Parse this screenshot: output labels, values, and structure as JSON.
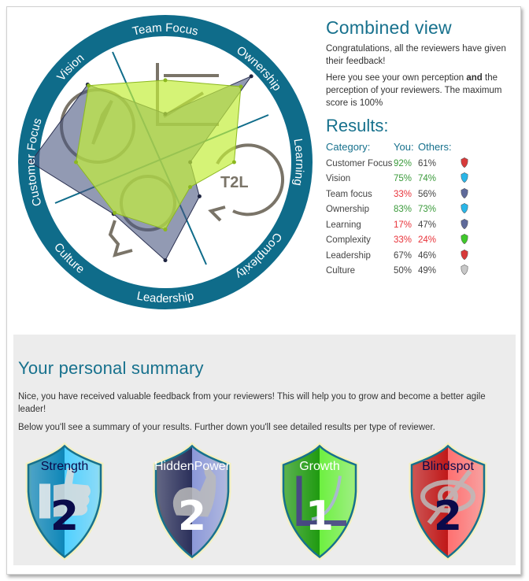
{
  "chart_data": {
    "type": "radar",
    "categories": [
      "Customer Focus",
      "Vision",
      "Team Focus",
      "Ownership",
      "Learning",
      "Complexity",
      "Leadership",
      "Culture"
    ],
    "series": [
      {
        "name": "You",
        "values": [
          92,
          75,
          33,
          83,
          17,
          33,
          67,
          50
        ],
        "color": "#4a5680"
      },
      {
        "name": "Others",
        "values": [
          61,
          74,
          56,
          73,
          47,
          24,
          46,
          49
        ],
        "color": "#c3ee3c"
      }
    ],
    "max": 100,
    "ring_color": "#0f6c8a",
    "icon_text": "T2L"
  },
  "header": {
    "title": "Combined view",
    "intro": "Congratulations, all the reviewers have given their feedback!",
    "desc_pre": "Here you see your own perception ",
    "desc_bold": "and",
    "desc_post": " the perception of your reviewers. The maximum score is 100%"
  },
  "results": {
    "title": "Results:",
    "col_category": "Category:",
    "col_you": "You:",
    "col_others": "Others:",
    "rows": [
      {
        "category": "Customer Focus",
        "you": "92%",
        "you_status": "good",
        "others": "61%",
        "others_status": "neutral",
        "shield": "#d83a3a"
      },
      {
        "category": "Vision",
        "you": "75%",
        "you_status": "good",
        "others": "74%",
        "others_status": "good",
        "shield": "#29b6e8"
      },
      {
        "category": "Team focus",
        "you": "33%",
        "you_status": "bad",
        "others": "56%",
        "others_status": "neutral",
        "shield": "#5f6a9a"
      },
      {
        "category": "Ownership",
        "you": "83%",
        "you_status": "good",
        "others": "73%",
        "others_status": "good",
        "shield": "#29b6e8"
      },
      {
        "category": "Learning",
        "you": "17%",
        "you_status": "bad",
        "others": "47%",
        "others_status": "neutral",
        "shield": "#5f6a9a"
      },
      {
        "category": "Complexity",
        "you": "33%",
        "you_status": "bad",
        "others": "24%",
        "others_status": "bad",
        "shield": "#3fc82a"
      },
      {
        "category": "Leadership",
        "you": "67%",
        "you_status": "neutral",
        "others": "46%",
        "others_status": "neutral",
        "shield": "#d83a3a"
      },
      {
        "category": "Culture",
        "you": "50%",
        "you_status": "neutral",
        "others": "49%",
        "others_status": "neutral",
        "shield": "#c8c8c8"
      }
    ]
  },
  "summary": {
    "title": "Your personal summary",
    "p1": "Nice, you have received valuable feedback from your reviewers! This will help you to grow and become a better agile leader!",
    "p2": "Below you'll see a summary of your results. Further down you'll see detailed results per type of reviewer.",
    "badges": [
      {
        "label": "Strength",
        "count": "2",
        "icon": "thumbs-up-icon",
        "dark": "#0d86b8",
        "light": "#4fd0ff",
        "text": "#0a0a4a",
        "num": "#0a0a4a"
      },
      {
        "label": "HiddenPower",
        "count": "2",
        "icon": "flexed-arm-icon",
        "dark": "#2a2f5a",
        "light": "#8b98d8",
        "text": "#ffffff",
        "num": "#ffffff"
      },
      {
        "label": "Growth",
        "count": "1",
        "icon": "growth-chart-icon",
        "dark": "#1f9a10",
        "light": "#6df040",
        "text": "#ffffff",
        "num": "#ffffff"
      },
      {
        "label": "Blindspot",
        "count": "2",
        "icon": "eye-slash-icon",
        "dark": "#c01818",
        "light": "#ff7070",
        "text": "#0a0a4a",
        "num": "#0a0a4a"
      }
    ]
  }
}
